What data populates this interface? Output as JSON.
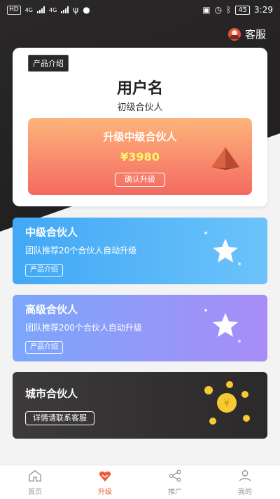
{
  "status_bar": {
    "left_chip": "HD",
    "net1": "4G",
    "net2": "4G",
    "battery": "45",
    "time": "3:29"
  },
  "header": {
    "service_label": "客服"
  },
  "main_card": {
    "intro_tag": "产品介绍",
    "username": "用户名",
    "level": "初级合伙人",
    "upgrade_title": "升级中级合伙人",
    "upgrade_price": "¥3980",
    "confirm_label": "确认升级"
  },
  "tiers": [
    {
      "title": "中级合伙人",
      "desc": "团队推荐20个合伙人自动升级",
      "button": "产品介绍"
    },
    {
      "title": "高级合伙人",
      "desc": "团队推荐200个合伙人自动升级",
      "button": "产品介绍"
    }
  ],
  "city": {
    "title": "城市合伙人",
    "button": "详情请联系客服"
  },
  "tabbar": {
    "items": [
      {
        "label": "首页",
        "icon": "home-icon"
      },
      {
        "label": "升级",
        "icon": "upgrade-icon"
      },
      {
        "label": "推广",
        "icon": "share-icon"
      },
      {
        "label": "我的",
        "icon": "user-icon"
      }
    ],
    "active": "升级",
    "accent": "#f05a3b"
  },
  "colors": {
    "dark_bg": "#2a2829",
    "upgrade_gradient": [
      "#fdb47a",
      "#f46a62"
    ],
    "mid_gradient": [
      "#41a8f5",
      "#6cc3fb"
    ],
    "high_gradient": [
      "#7aa7fb",
      "#a88cf7"
    ],
    "price": "#fff66a"
  }
}
